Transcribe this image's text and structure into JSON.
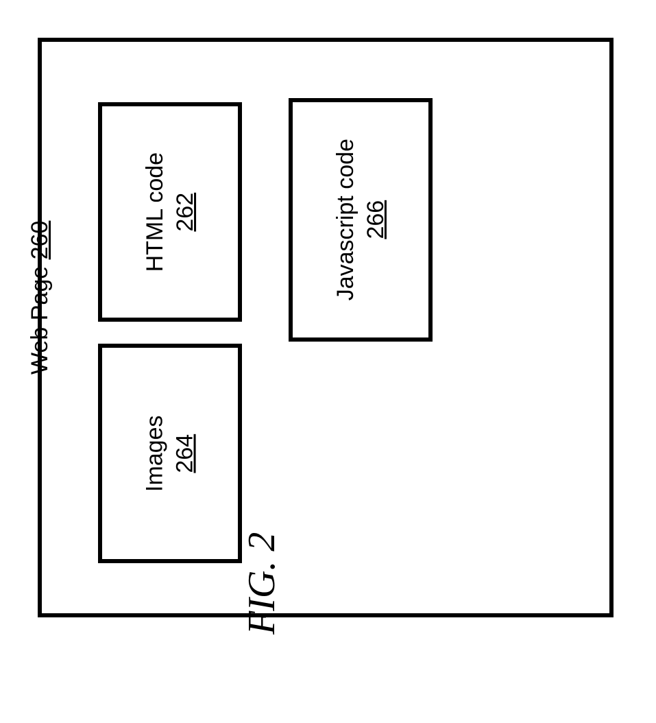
{
  "diagram": {
    "container": {
      "label": "Web Page",
      "number": "260"
    },
    "boxes": {
      "html": {
        "label": "HTML code",
        "number": "262"
      },
      "images": {
        "label": "Images",
        "number": "264"
      },
      "js": {
        "label": "Javascript code",
        "number": "266"
      }
    }
  },
  "caption": "FIG. 2"
}
